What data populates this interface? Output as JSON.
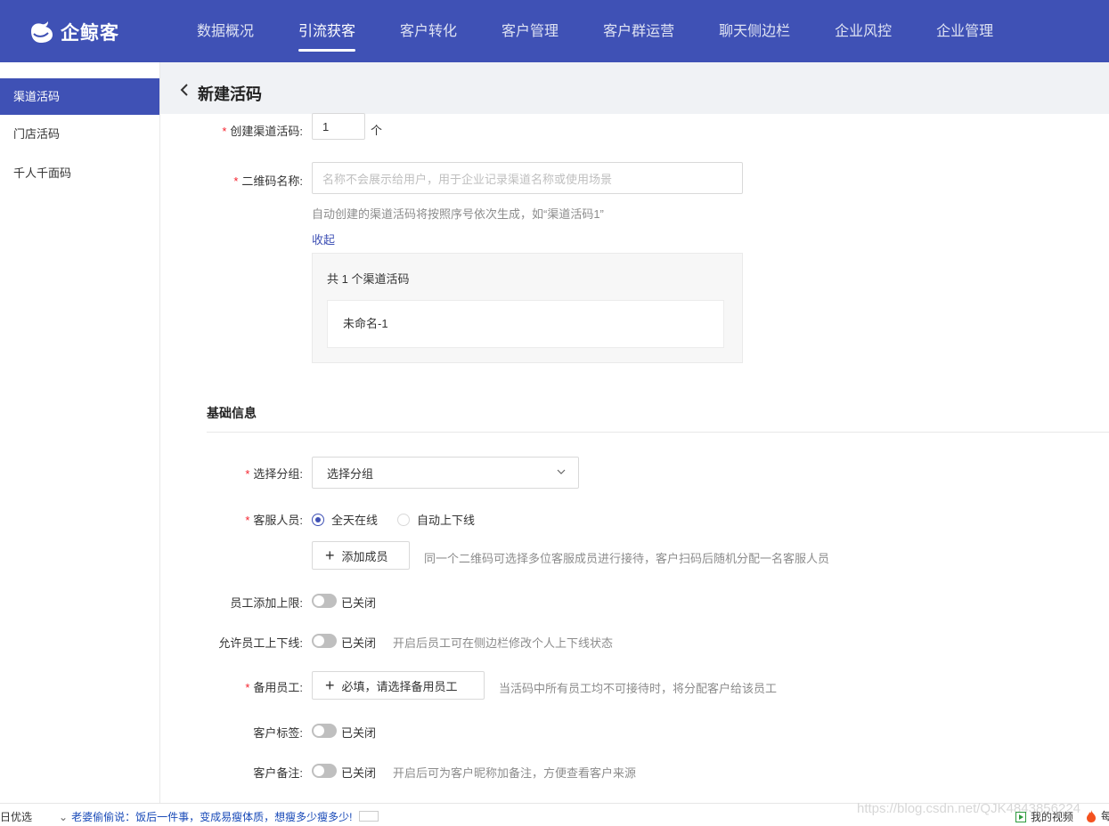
{
  "header": {
    "brand": "企鲸客",
    "nav": [
      "数据概况",
      "引流获客",
      "客户转化",
      "客户管理",
      "客户群运营",
      "聊天侧边栏",
      "企业风控",
      "企业管理"
    ],
    "active_nav": "引流获客"
  },
  "sidebar": {
    "items": [
      "渠道活码",
      "门店活码",
      "千人千面码"
    ],
    "active": "渠道活码"
  },
  "page": {
    "title": "新建活码"
  },
  "form": {
    "create_count_label": "创建渠道活码:",
    "create_count_value": "1",
    "create_count_unit": "个",
    "qr_name_label": "二维码名称:",
    "qr_name_placeholder": "名称不会展示给用户，用于企业记录渠道名称或使用场景",
    "qr_name_hint": "自动创建的渠道活码将按照序号依次生成，如“渠道活码1”",
    "collapse_link": "收起",
    "preview_count": "共 1 个渠道活码",
    "preview_items": [
      "未命名-1"
    ],
    "basic_section": "基础信息",
    "group_label": "选择分组:",
    "group_value": "选择分组",
    "staff_label": "客服人员:",
    "staff_options": [
      "全天在线",
      "自动上下线"
    ],
    "staff_selected": "全天在线",
    "add_member_button": "添加成员",
    "add_member_hint": "同一个二维码可选择多位客服成员进行接待，客户扫码后随机分配一名客服人员",
    "limit_label": "员工添加上限:",
    "limit_state": "已关闭",
    "online_label": "允许员工上下线:",
    "online_state": "已关闭",
    "online_hint": "开启后员工可在侧边栏修改个人上下线状态",
    "backup_label": "备用员工:",
    "backup_button": "必填，请选择备用员工",
    "backup_hint": "当活码中所有员工均不可接待时，将分配客户给该员工",
    "tag_label": "客户标签:",
    "tag_state": "已关闭",
    "remark_label": "客户备注:",
    "remark_state": "已关闭",
    "remark_hint": "开启后可为客户昵称加备注，方便查看客户来源"
  },
  "browser_bar": {
    "left_text": "日优选",
    "news": "老婆偷偷说：饭后一件事，变成易瘦体质，想瘦多少瘦多少!",
    "watermark": "https://blog.csdn.net/QJK4843856224",
    "video": "我的视频",
    "fire_text": "每"
  },
  "colors": {
    "primary": "#3f51b5",
    "required": "#f5222d"
  }
}
